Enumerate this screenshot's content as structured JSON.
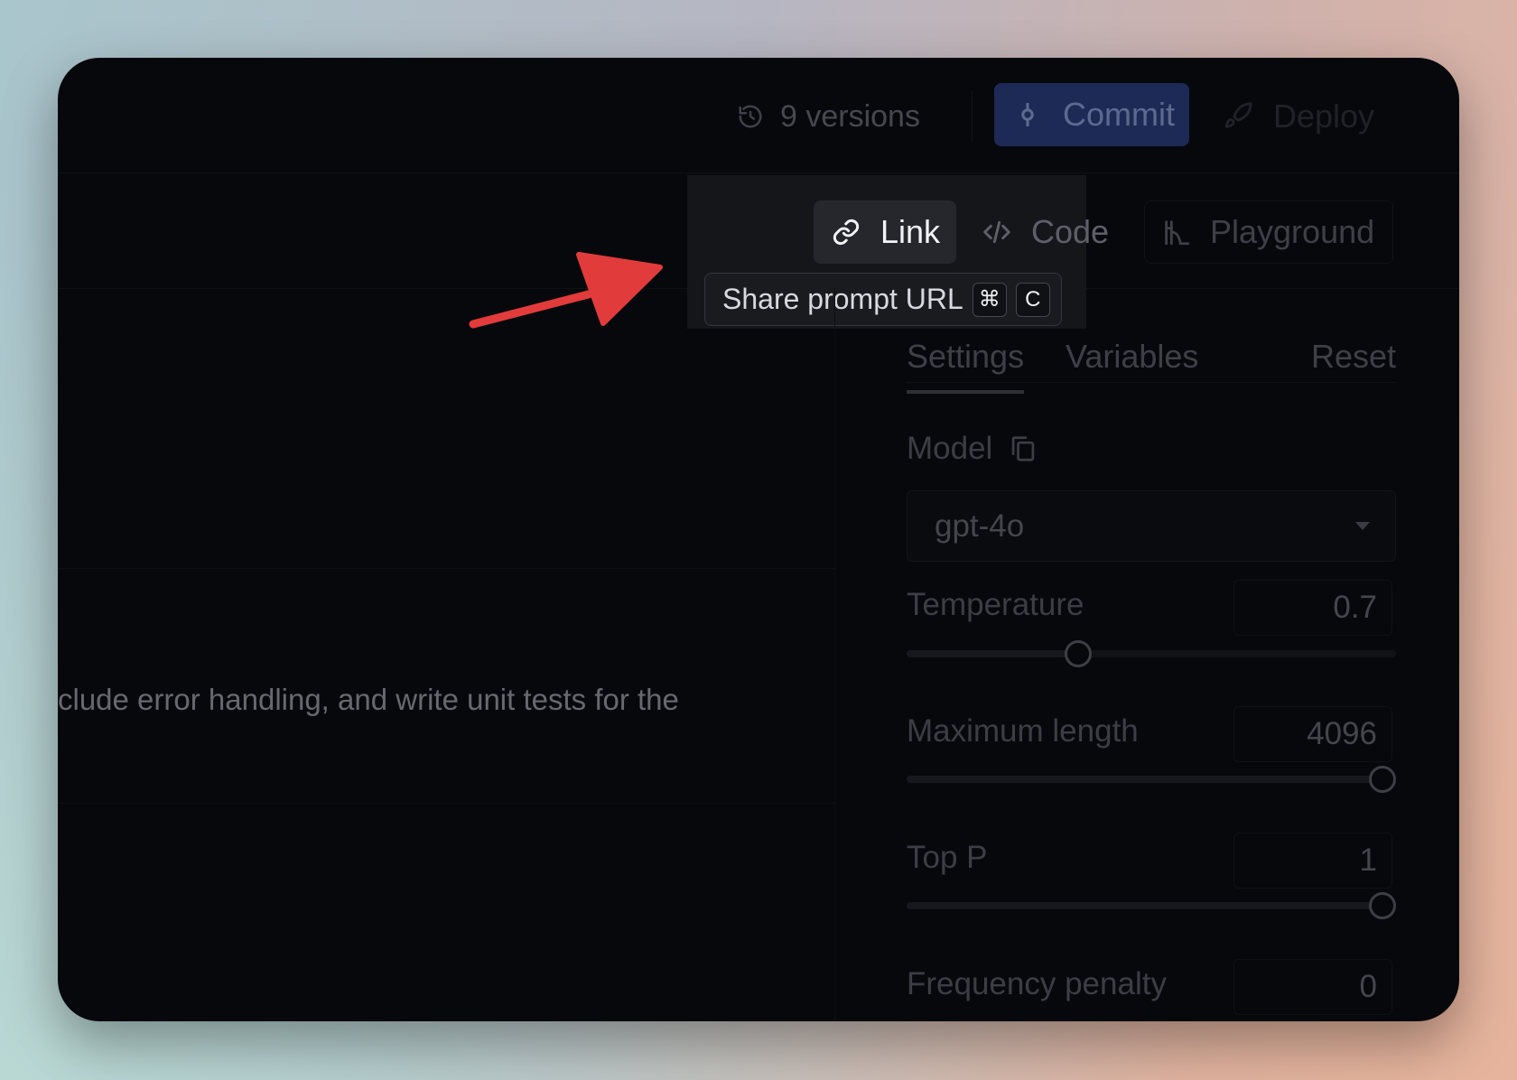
{
  "header": {
    "versions_label": "9 versions",
    "commit_label": "Commit",
    "deploy_label": "Deploy"
  },
  "tabs": {
    "link_label": "Link",
    "code_label": "Code",
    "playground_label": "Playground"
  },
  "tooltip": {
    "text": "Share prompt URL",
    "key1": "⌘",
    "key2": "C"
  },
  "editor": {
    "text": "clude error handling, and write unit tests for the"
  },
  "settings": {
    "tabs": {
      "settings": "Settings",
      "variables": "Variables",
      "reset": "Reset"
    },
    "model_label": "Model",
    "model_value": "gpt-4o",
    "temperature_label": "Temperature",
    "temperature_value": "0.7",
    "temperature_fraction": 0.35,
    "max_length_label": "Maximum length",
    "max_length_value": "4096",
    "max_length_fraction": 1.0,
    "top_p_label": "Top P",
    "top_p_value": "1",
    "top_p_fraction": 1.0,
    "freq_penalty_label": "Frequency penalty",
    "freq_penalty_value": "0"
  },
  "colors": {
    "commit_bg": "#1d2a55",
    "arrow": "#e23b3b",
    "window_bg": "#07080b"
  }
}
